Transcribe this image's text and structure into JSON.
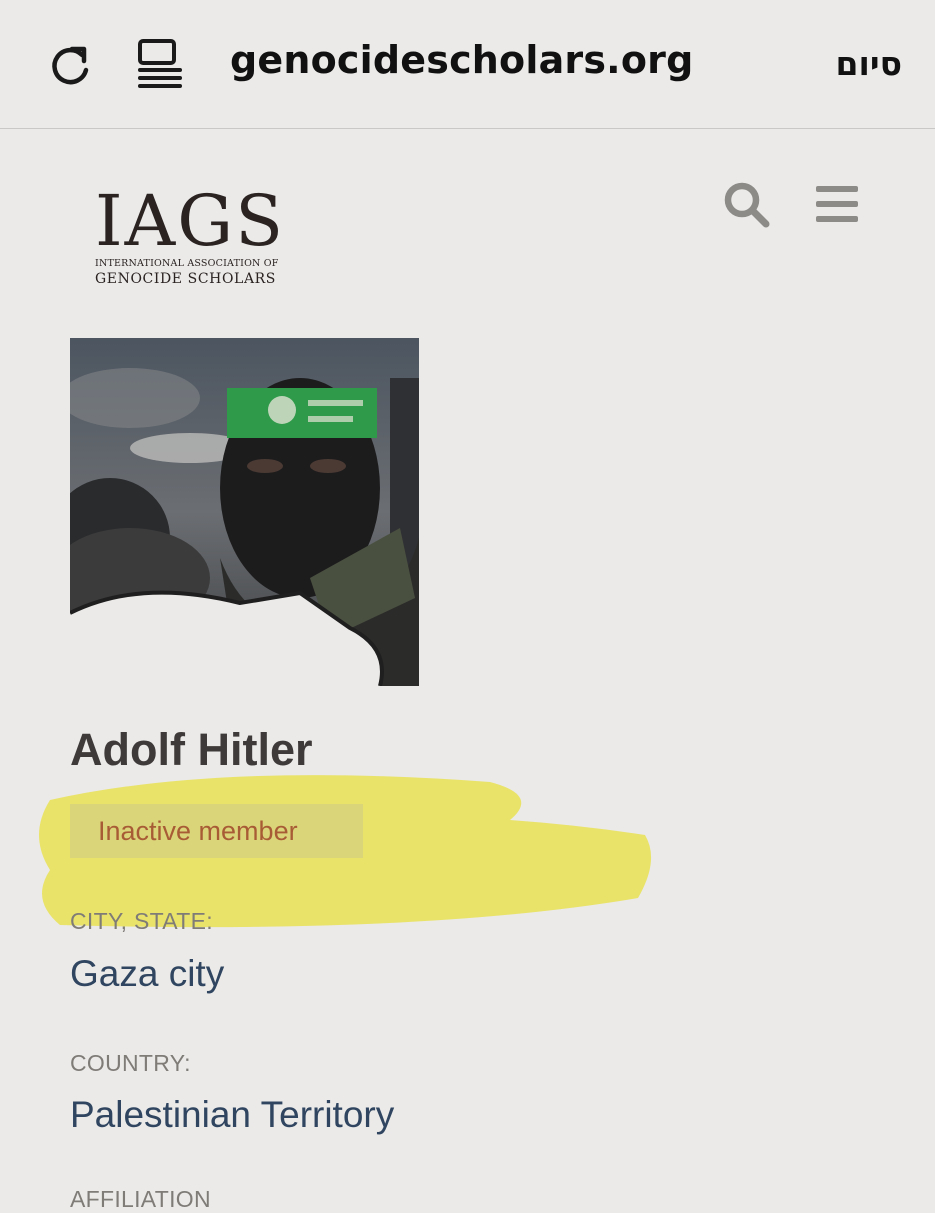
{
  "browser": {
    "url": "genocidescholars.org",
    "done_label": "סיום"
  },
  "logo": {
    "mark": "IAGS",
    "line1": "INTERNATIONAL ASSOCIATION OF",
    "line2": "GENOCIDE SCHOLARS"
  },
  "profile": {
    "name": "Adolf Hitler",
    "status": "Inactive member",
    "fields": [
      {
        "label": "CITY, STATE:",
        "value": "Gaza city"
      },
      {
        "label": "COUNTRY:",
        "value": "Palestinian Territory"
      },
      {
        "label": "AFFILIATION",
        "value": ""
      }
    ]
  },
  "colors": {
    "page_background": "#ebeae8",
    "highlight": "#e9e25c",
    "status_text": "#a85c35",
    "value_text": "#2f4560",
    "label_text": "#7f7c78"
  },
  "icons": {
    "reload": "reload-icon",
    "reader": "reader-icon",
    "search": "search-icon",
    "menu": "menu-icon"
  }
}
